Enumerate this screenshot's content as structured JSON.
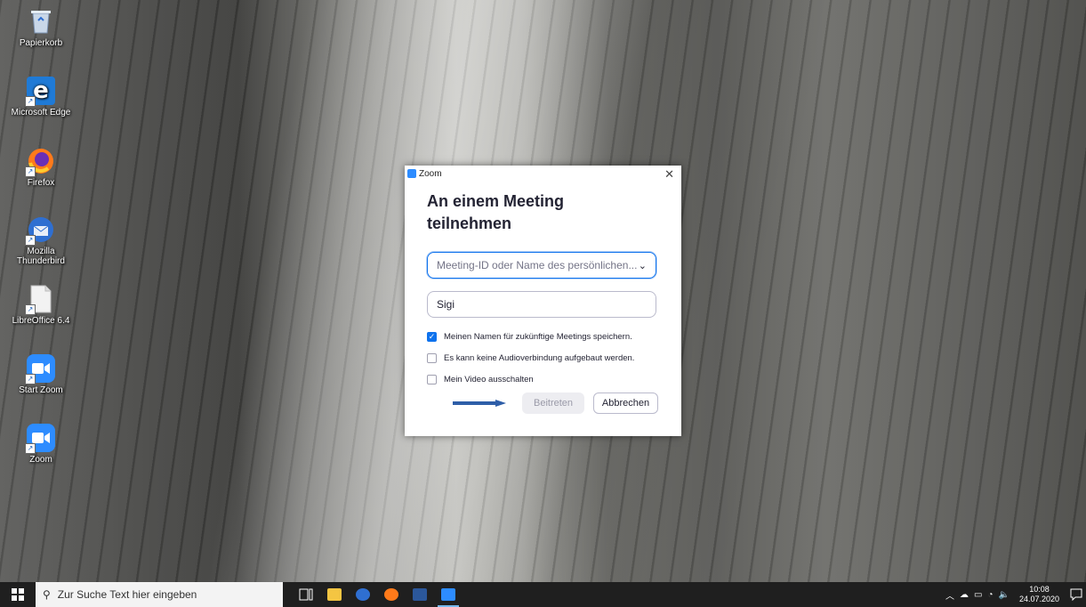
{
  "desktop": {
    "icons": [
      {
        "label": "Papierkorb",
        "icon": "recycle-bin-icon",
        "color": "#9bb6d6"
      },
      {
        "label": "Microsoft Edge",
        "icon": "edge-icon",
        "color": "#1f7ad6"
      },
      {
        "label": "Firefox",
        "icon": "firefox-icon",
        "color": "#ff7a1a"
      },
      {
        "label": "Mozilla Thunderbird",
        "icon": "thunderbird-icon",
        "color": "#2f6fd1"
      },
      {
        "label": "LibreOffice 6.4",
        "icon": "libreoffice-icon",
        "color": "#f2f2f2"
      },
      {
        "label": "Start Zoom",
        "icon": "zoom-icon",
        "color": "#2d8cff"
      },
      {
        "label": "Zoom",
        "icon": "zoom-icon",
        "color": "#2d8cff"
      }
    ]
  },
  "dialog": {
    "window_title": "Zoom",
    "heading": "An einem Meeting teilnehmen",
    "meeting_placeholder": "Meeting-ID oder Name des persönlichen...",
    "name_value": "Sigi",
    "options": [
      {
        "label": "Meinen Namen für zukünftige Meetings speichern.",
        "checked": true
      },
      {
        "label": "Es kann keine Audioverbindung aufgebaut werden.",
        "checked": false
      },
      {
        "label": "Mein Video ausschalten",
        "checked": false
      }
    ],
    "join_label": "Beitreten",
    "cancel_label": "Abbrechen",
    "accent_color": "#0e72ed"
  },
  "taskbar": {
    "search_placeholder": "Zur Suche Text hier eingeben",
    "apps": [
      "task-view-icon",
      "file-explorer-icon",
      "thunderbird-icon",
      "firefox-icon",
      "word-icon",
      "zoom-icon"
    ],
    "time": "10:08",
    "date": "24.07.2020"
  }
}
